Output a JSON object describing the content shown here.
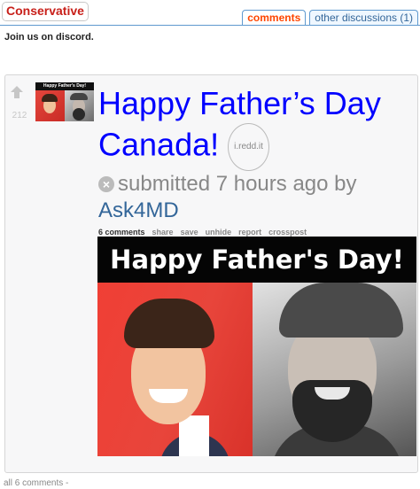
{
  "subreddit": {
    "name": "Conservative"
  },
  "tabs": [
    {
      "label": "comments"
    },
    {
      "label": "other discussions (1)"
    }
  ],
  "notice": "Join us on discord.",
  "post": {
    "score": "212",
    "thumbnail_text": "Happy Father's Day!",
    "title": "Happy Father’s Day Canada!",
    "domain": "i.redd.it",
    "x_icon": "×",
    "submitted": "submitted 7 hours ago by",
    "author": "Ask4MD",
    "actions": {
      "comments": "6 comments",
      "share": "share",
      "save": "save",
      "unhide": "unhide",
      "report": "report",
      "crosspost": "crosspost"
    },
    "image_caption": "Happy Father's Day!"
  },
  "footer": {
    "all_comments": "all 6 comments -"
  }
}
